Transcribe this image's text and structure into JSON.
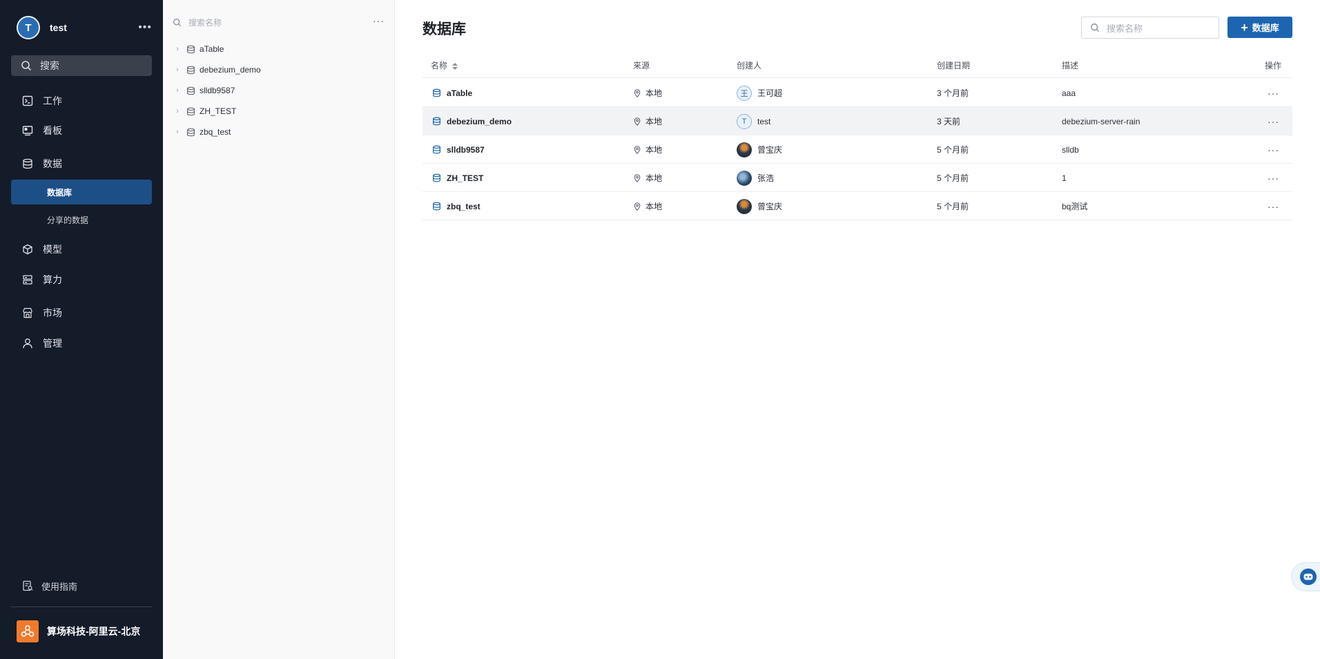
{
  "user": {
    "initial": "T",
    "name": "test",
    "more": "•••"
  },
  "nav": {
    "search_label": "搜索",
    "items": [
      {
        "label": "工作",
        "icon": "terminal-icon"
      },
      {
        "label": "看板",
        "icon": "monitor-icon"
      },
      {
        "label": "数据",
        "icon": "database-icon"
      },
      {
        "label": "模型",
        "icon": "cube-icon"
      },
      {
        "label": "算力",
        "icon": "server-icon"
      },
      {
        "label": "市场",
        "icon": "store-icon"
      },
      {
        "label": "管理",
        "icon": "user-icon"
      }
    ],
    "sub_items": [
      {
        "label": "数据库",
        "active": true
      },
      {
        "label": "分享的数据",
        "active": false
      }
    ],
    "guide_label": "使用指南",
    "org_name": "算场科技-阿里云-北京"
  },
  "tree": {
    "search_placeholder": "搜索名称",
    "more": "···",
    "items": [
      "aTable",
      "debezium_demo",
      "slldb9587",
      "ZH_TEST",
      "zbq_test"
    ]
  },
  "main": {
    "title": "数据库",
    "search_placeholder": "搜索名称",
    "add_button_label": "数据库",
    "columns": {
      "name": "名称",
      "source": "来源",
      "creator": "创建人",
      "created": "创建日期",
      "description": "描述",
      "actions": "操作"
    },
    "rows": [
      {
        "name": "aTable",
        "source": "本地",
        "creator": "王可超",
        "creator_avatar": "王",
        "created": "3 个月前",
        "description": "aaa"
      },
      {
        "name": "debezium_demo",
        "source": "本地",
        "creator": "test",
        "creator_avatar": "T",
        "created": "3 天前",
        "description": "debezium-server-rain"
      },
      {
        "name": "slldb9587",
        "source": "本地",
        "creator": "曾宝庆",
        "creator_avatar": "",
        "created": "5 个月前",
        "description": "slldb"
      },
      {
        "name": "ZH_TEST",
        "source": "本地",
        "creator": "张浩",
        "creator_avatar": "",
        "created": "5 个月前",
        "description": "1"
      },
      {
        "name": "zbq_test",
        "source": "本地",
        "creator": "曾宝庆",
        "creator_avatar": "",
        "created": "5 个月前",
        "description": "bq测试"
      }
    ],
    "row_more": "···"
  },
  "colors": {
    "nav_bg": "#141b29",
    "accent": "#1d65b0",
    "active_nav": "#1d4f87",
    "org_logo": "#f07a2c"
  }
}
